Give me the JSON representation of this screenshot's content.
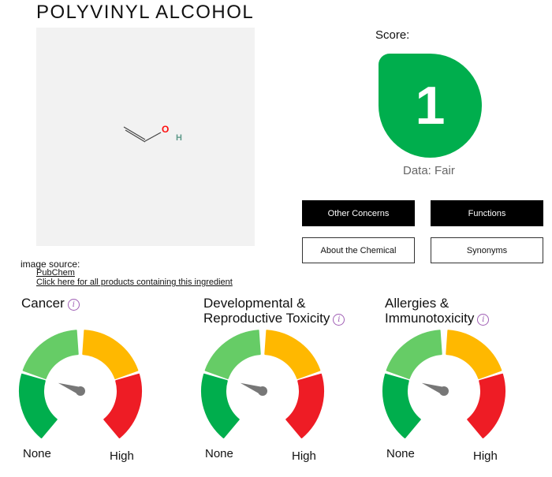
{
  "title": "POLYVINYL ALCOHOL",
  "structure": {
    "atoms": {
      "oxygen": "O",
      "hydrogen": "H"
    }
  },
  "score": {
    "label": "Score:",
    "value": "1",
    "data_label": "Data: Fair",
    "color": "#00ae4d"
  },
  "buttons": {
    "other_concerns": "Other Concerns",
    "functions": "Functions",
    "about": "About the Chemical",
    "synonyms": "Synonyms"
  },
  "source": {
    "label": "image source:",
    "pubchem": "PubChem",
    "all_products": "Click here for all products containing this ingredient"
  },
  "hazards": [
    {
      "title_line1": "Cancer",
      "title_line2": "",
      "low": "None",
      "high": "High",
      "level": 0.25
    },
    {
      "title_line1": "Developmental &",
      "title_line2": "Reproductive Toxicity",
      "low": "None",
      "high": "High",
      "level": 0.25
    },
    {
      "title_line1": "Allergies &",
      "title_line2": "Immunotoxicity",
      "low": "None",
      "high": "High",
      "level": 0.25
    }
  ],
  "gauge_colors": [
    "#00ae4d",
    "#66cc66",
    "#ffb800",
    "#ee1c25"
  ],
  "needle_color": "#777777"
}
